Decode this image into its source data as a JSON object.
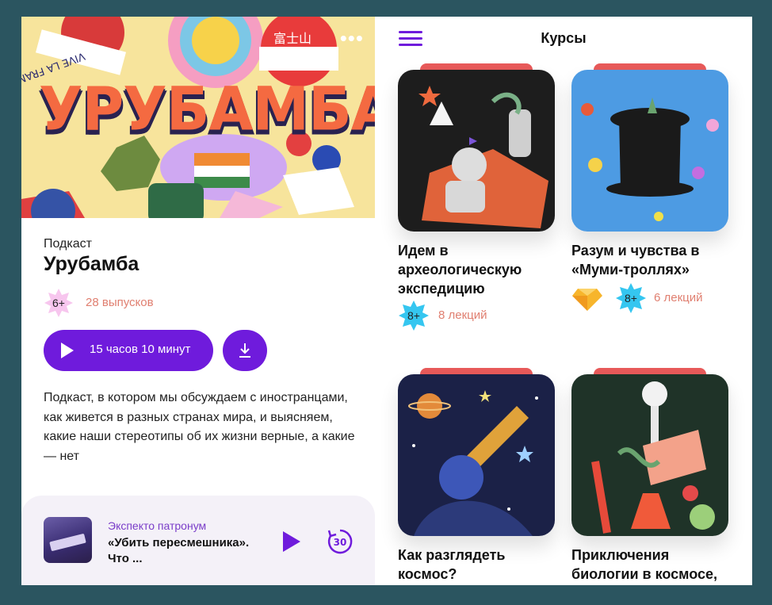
{
  "podcast": {
    "cover_text": "УРУБАМБА",
    "cover_sticker": "VIVE LA FRANCE",
    "cover_sign": "富士山",
    "kind": "Подкаст",
    "title": "Урубамба",
    "age": "6+",
    "episodes": "28 выпусков",
    "play_label": "15 часов 10 минут",
    "description": "Подкаст, в котором мы обсуждаем с иностранцами, как живется в разных странах мира, и выясняем, какие наши стереотипы об их жизни верные, а какие — нет"
  },
  "mini_player": {
    "show": "Экспекто патронум",
    "episode": "«Убить пересмешника». Что ...",
    "rewind": "30"
  },
  "courses": {
    "header": "Курсы",
    "items": [
      {
        "title": "Идем в археологическую экспедицию",
        "age": "8+",
        "lectures": "8 лекций",
        "premium": false
      },
      {
        "title": "Разум и чувства в «Муми-троллях»",
        "age": "8+",
        "lectures": "6 лекций",
        "premium": true
      },
      {
        "title": "Как разглядеть космос?",
        "age": "",
        "lectures": "",
        "premium": false
      },
      {
        "title": "Приключения биологии в космосе,",
        "age": "",
        "lectures": "",
        "premium": false
      }
    ]
  },
  "icons": {
    "back": "arrow-left-icon",
    "more": "more-dots-icon",
    "play": "play-icon",
    "download": "download-icon",
    "menu": "hamburger-menu-icon",
    "replay30": "rewind-30-icon",
    "premium": "diamond-icon"
  },
  "colors": {
    "accent": "#6f1bdc",
    "muted_count": "#e07f70",
    "badge_pink": "#f7c6ee",
    "badge_cyan": "#35c6f0",
    "card_tab": "#e85a5a"
  }
}
